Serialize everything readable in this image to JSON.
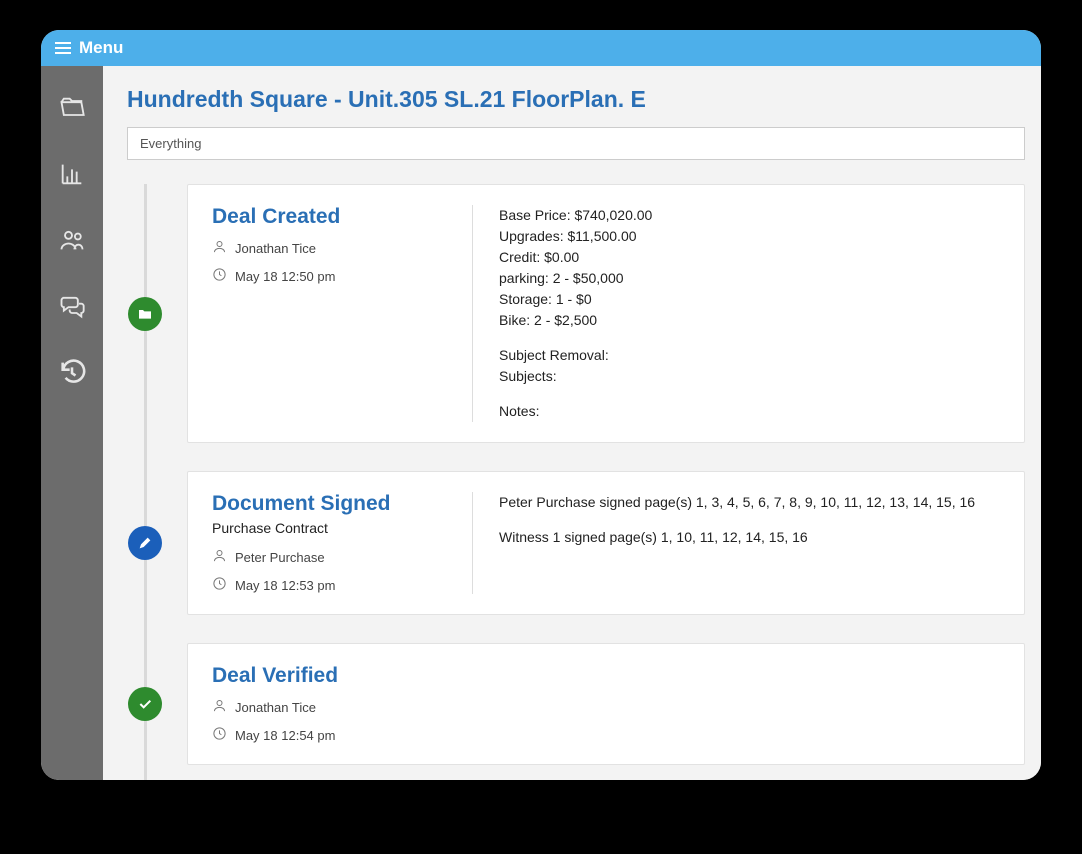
{
  "titlebar": {
    "label": "Menu"
  },
  "page_title": "Hundredth Square - Unit.305 SL.21 FloorPlan. E",
  "filter": {
    "value": "Everything"
  },
  "timeline": [
    {
      "dot_color": "green",
      "dot_icon": "folder",
      "title": "Deal Created",
      "subtitle": "",
      "user": "Jonathan Tice",
      "time": "May 18 12:50 pm",
      "details": [
        "Base Price: $740,020.00",
        "Upgrades: $11,500.00",
        "Credit: $0.00",
        "parking: 2 - $50,000",
        "Storage: 1 - $0",
        "Bike: 2 - $2,500",
        "",
        "Subject Removal:",
        "Subjects:",
        "",
        "Notes:"
      ]
    },
    {
      "dot_color": "blue",
      "dot_icon": "pencil",
      "title": "Document Signed",
      "subtitle": "Purchase Contract",
      "user": "Peter Purchase",
      "time": "May 18 12:53 pm",
      "details": [
        "Peter Purchase signed page(s) 1, 3, 4, 5, 6, 7, 8, 9, 10, 11, 12, 13, 14, 15, 16",
        "",
        "Witness 1 signed page(s) 1, 10, 11, 12, 14, 15, 16"
      ]
    },
    {
      "dot_color": "green",
      "dot_icon": "check",
      "title": "Deal Verified",
      "subtitle": "",
      "user": "Jonathan Tice",
      "time": "May 18 12:54 pm",
      "details": []
    }
  ]
}
